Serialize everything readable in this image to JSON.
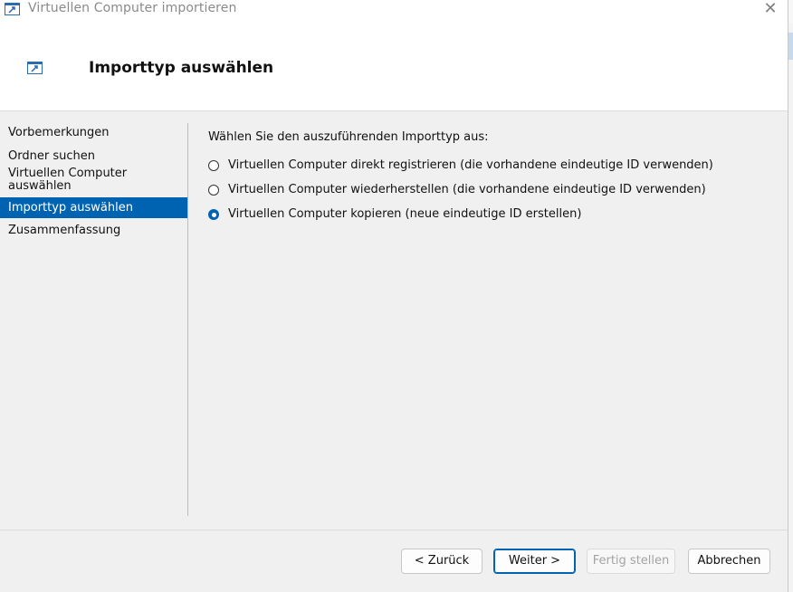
{
  "window": {
    "title": "Virtuellen Computer importieren",
    "close_glyph": "✕"
  },
  "header": {
    "title": "Importtyp auswählen"
  },
  "nav": {
    "items": [
      {
        "label": "Vorbemerkungen"
      },
      {
        "label": "Ordner suchen"
      },
      {
        "label": "Virtuellen Computer auswählen"
      },
      {
        "label": "Importtyp auswählen"
      },
      {
        "label": "Zusammenfassung"
      }
    ],
    "active_index": 3
  },
  "main": {
    "prompt": "Wählen Sie den auszuführenden Importtyp aus:",
    "options": [
      {
        "label": "Virtuellen Computer direkt registrieren (die vorhandene eindeutige ID verwenden)",
        "checked": false
      },
      {
        "label": "Virtuellen Computer wiederherstellen (die vorhandene eindeutige ID verwenden)",
        "checked": false
      },
      {
        "label": "Virtuellen Computer kopieren (neue eindeutige ID erstellen)",
        "checked": true
      }
    ]
  },
  "buttons": {
    "back": "< Zurück",
    "next": "Weiter >",
    "finish": "Fertig stellen",
    "cancel": "Abbrechen"
  },
  "icons": {
    "app": "import-vm-icon",
    "close": "close-icon"
  },
  "colors": {
    "accent": "#0063b1",
    "dialog_bg": "#f0f0f0"
  }
}
